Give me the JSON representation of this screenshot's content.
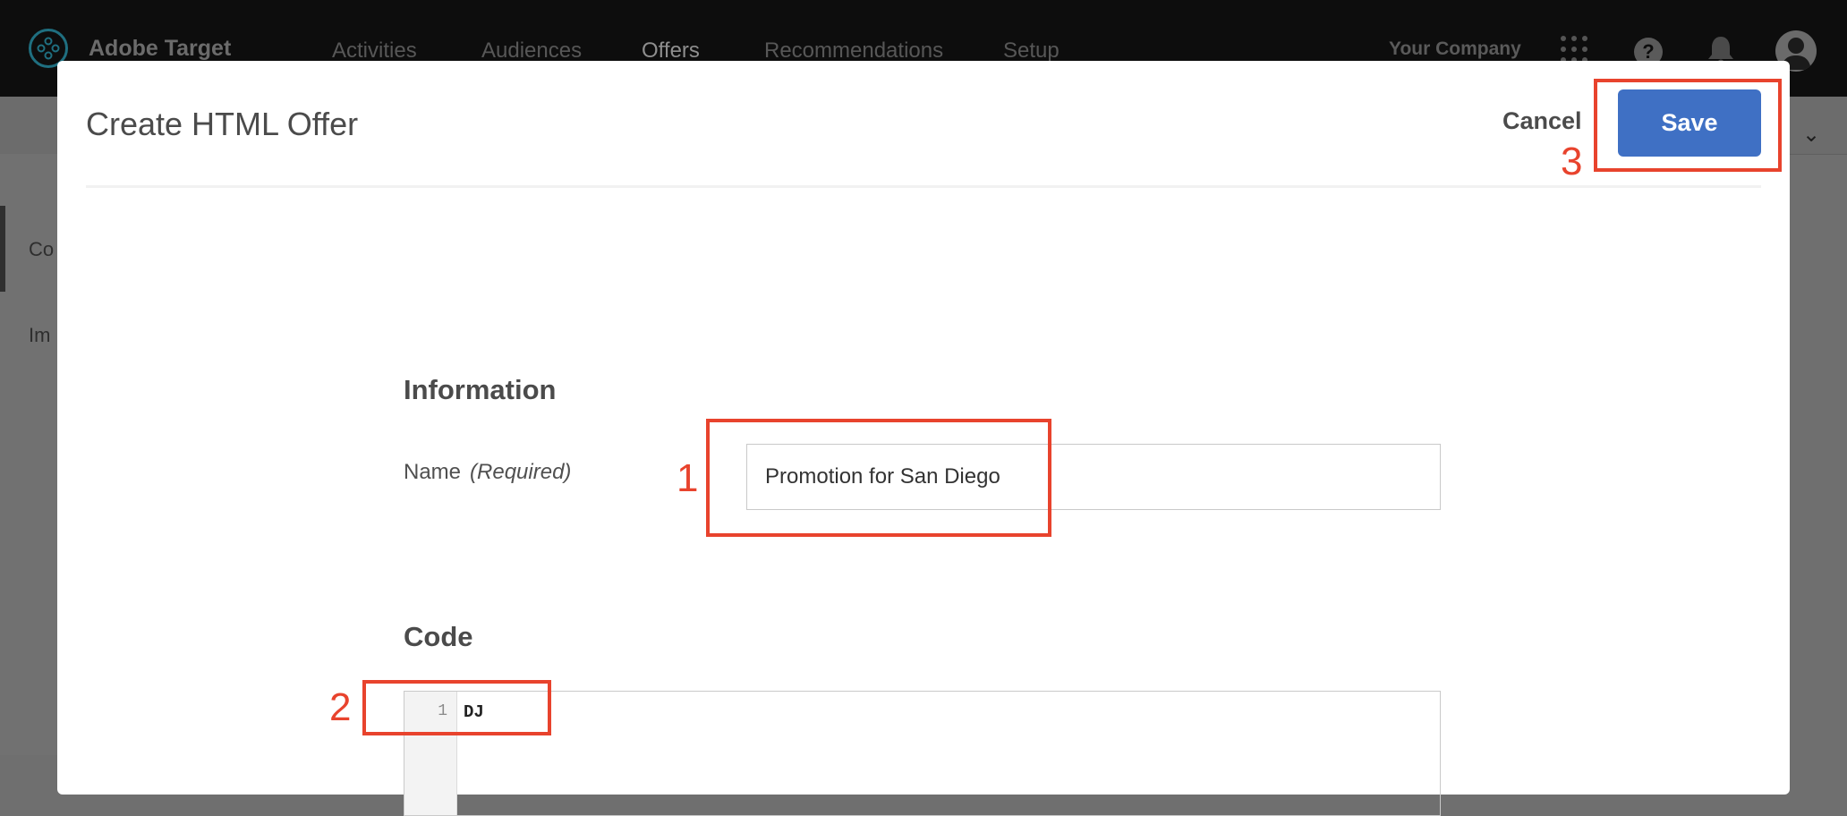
{
  "topbar": {
    "brand": "Adobe Target",
    "nav": [
      "Activities",
      "Audiences",
      "Offers",
      "Recommendations",
      "Setup"
    ],
    "active_nav": "Offers",
    "company": "Your Company",
    "icons": [
      "apps-grid-icon",
      "help-icon",
      "bell-icon",
      "avatar-icon"
    ]
  },
  "background": {
    "left_items": [
      "Co",
      "Im"
    ]
  },
  "modal": {
    "title": "Create HTML Offer",
    "cancel_label": "Cancel",
    "save_label": "Save",
    "information_heading": "Information",
    "name_label": "Name",
    "name_required": "(Required)",
    "name_value": "Promotion for San Diego",
    "code_heading": "Code",
    "code_line_number": "1",
    "code_line_text": "DJ"
  },
  "callouts": [
    "1",
    "2",
    "3"
  ],
  "colors": {
    "accent": "#3f70c4",
    "callout": "#e8432d"
  }
}
